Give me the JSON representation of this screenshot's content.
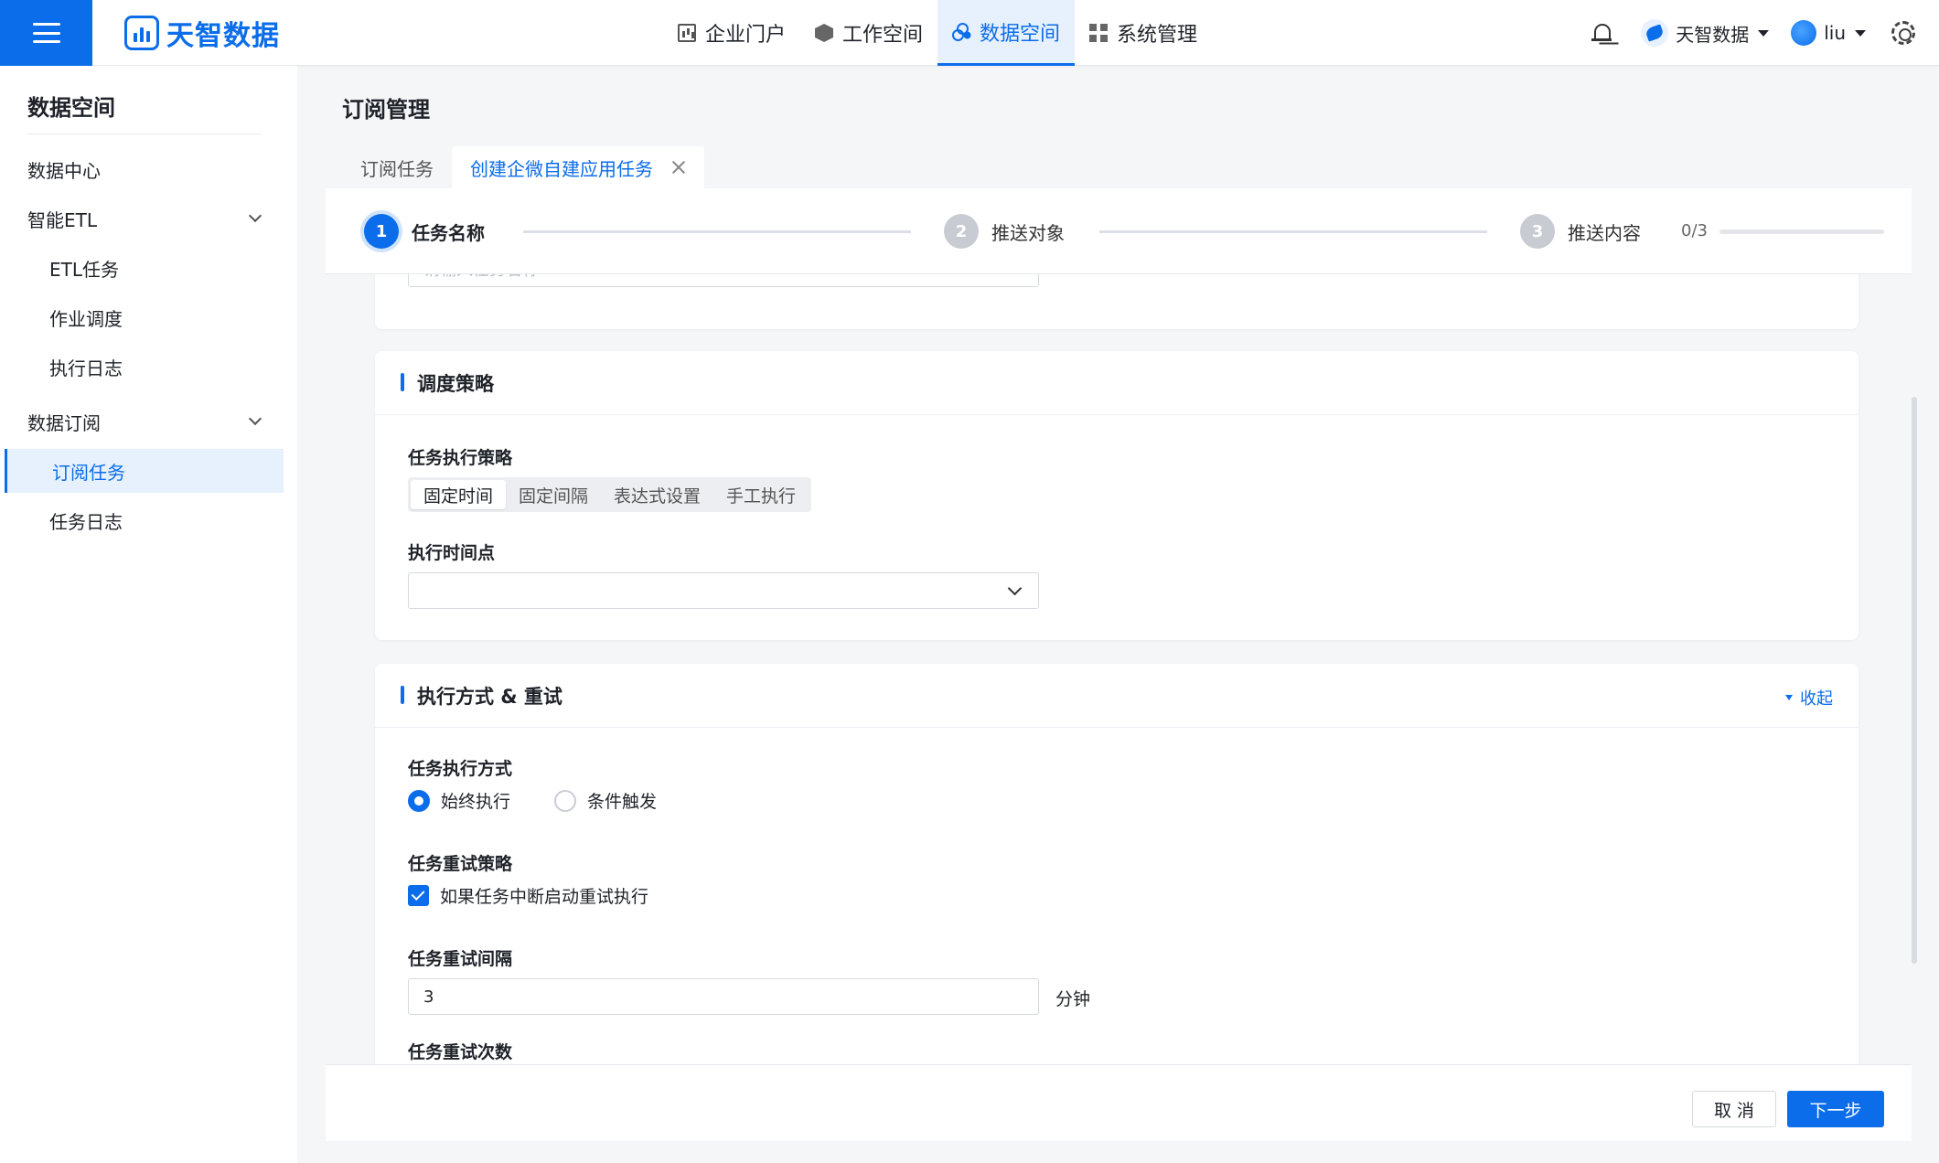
{
  "header": {
    "logo_text": "天智数据",
    "nav": [
      {
        "label": "企业门户",
        "icon": "monitor-icon",
        "active": false
      },
      {
        "label": "工作空间",
        "icon": "cube-icon",
        "active": false
      },
      {
        "label": "数据空间",
        "icon": "share-nodes-icon",
        "active": true
      },
      {
        "label": "系统管理",
        "icon": "grid-icon",
        "active": false
      }
    ],
    "tenant": "天智数据",
    "user": "liu"
  },
  "sidebar": {
    "title": "数据空间",
    "items": [
      {
        "label": "数据中心",
        "level": 1
      },
      {
        "label": "智能ETL",
        "level": 1,
        "expandable": true
      },
      {
        "label": "ETL任务",
        "level": 2
      },
      {
        "label": "作业调度",
        "level": 2
      },
      {
        "label": "执行日志",
        "level": 2
      },
      {
        "label": "数据订阅",
        "level": 1,
        "expandable": true
      },
      {
        "label": "订阅任务",
        "level": 2,
        "active": true
      },
      {
        "label": "任务日志",
        "level": 2
      }
    ]
  },
  "page": {
    "title": "订阅管理",
    "tabs": [
      {
        "label": "订阅任务",
        "active": false
      },
      {
        "label": "创建企微自建应用任务",
        "active": true,
        "closable": true
      }
    ]
  },
  "steps": {
    "items": [
      {
        "num": "1",
        "label": "任务名称",
        "active": true
      },
      {
        "num": "2",
        "label": "推送对象",
        "active": false
      },
      {
        "num": "3",
        "label": "推送内容",
        "active": false
      }
    ],
    "progress_text": "0/3",
    "progress_fraction": 0
  },
  "task_name": {
    "placeholder": "请输入任务名称"
  },
  "schedule": {
    "title": "调度策略",
    "strategy_label": "任务执行策略",
    "options": [
      "固定时间",
      "固定间隔",
      "表达式设置",
      "手工执行"
    ],
    "selected": "固定时间",
    "time_label": "执行时间点",
    "time_value": ""
  },
  "execution": {
    "title": "执行方式 & 重试",
    "collapse_label": "收起",
    "mode_label": "任务执行方式",
    "modes": [
      {
        "label": "始终执行",
        "selected": true
      },
      {
        "label": "条件触发",
        "selected": false
      }
    ],
    "retry_label": "任务重试策略",
    "retry_checkbox": "如果任务中断启动重试执行",
    "retry_checked": true,
    "interval_label": "任务重试间隔",
    "interval_value": "3",
    "interval_unit": "分钟",
    "count_label": "任务重试次数"
  },
  "footer": {
    "cancel": "取 消",
    "next": "下一步"
  },
  "colors": {
    "primary": "#0b6dea",
    "active_bg": "#e6f1fd"
  }
}
